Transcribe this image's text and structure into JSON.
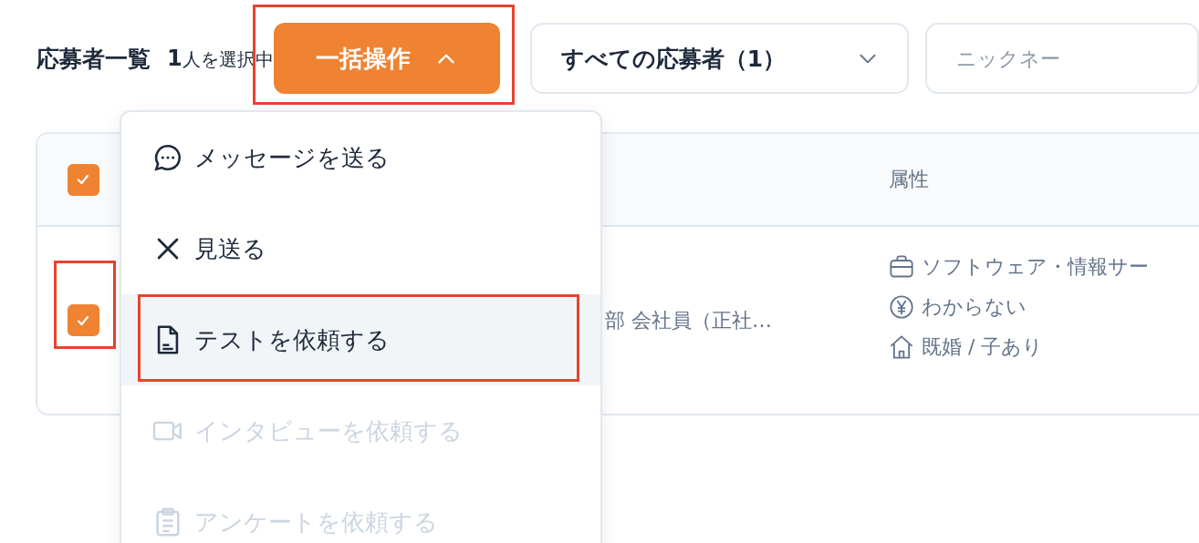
{
  "header": {
    "title": "応募者一覧",
    "selected_count": "1",
    "selected_suffix": "人を選択中"
  },
  "bulk_button": {
    "label": "一括操作",
    "expanded": true,
    "highlighted": true
  },
  "filter_dropdown": {
    "label": "すべての応募者（1）"
  },
  "search": {
    "placeholder": "ニックネー"
  },
  "table": {
    "header": {
      "checked": true,
      "attribute_column": "属性"
    },
    "rows": [
      {
        "checked": true,
        "highlighted": true,
        "occupation": "部 会社員（正社…",
        "attributes": [
          {
            "kind": "industry",
            "text": "ソフトウェア・情報サー"
          },
          {
            "kind": "income",
            "text": "わからない"
          },
          {
            "kind": "family",
            "text": "既婚 / 子あり"
          }
        ]
      }
    ]
  },
  "menu": {
    "items": [
      {
        "kind": "message",
        "label": "メッセージを送る",
        "disabled": false,
        "selected": false,
        "highlighted": false
      },
      {
        "kind": "decline",
        "label": "見送る",
        "disabled": false,
        "selected": false,
        "highlighted": false
      },
      {
        "kind": "test",
        "label": "テストを依頼する",
        "disabled": false,
        "selected": true,
        "highlighted": true
      },
      {
        "kind": "interview",
        "label": "インタビューを依頼する",
        "disabled": true,
        "selected": false,
        "highlighted": false
      },
      {
        "kind": "survey",
        "label": "アンケートを依頼する",
        "disabled": true,
        "selected": false,
        "highlighted": false
      }
    ]
  }
}
